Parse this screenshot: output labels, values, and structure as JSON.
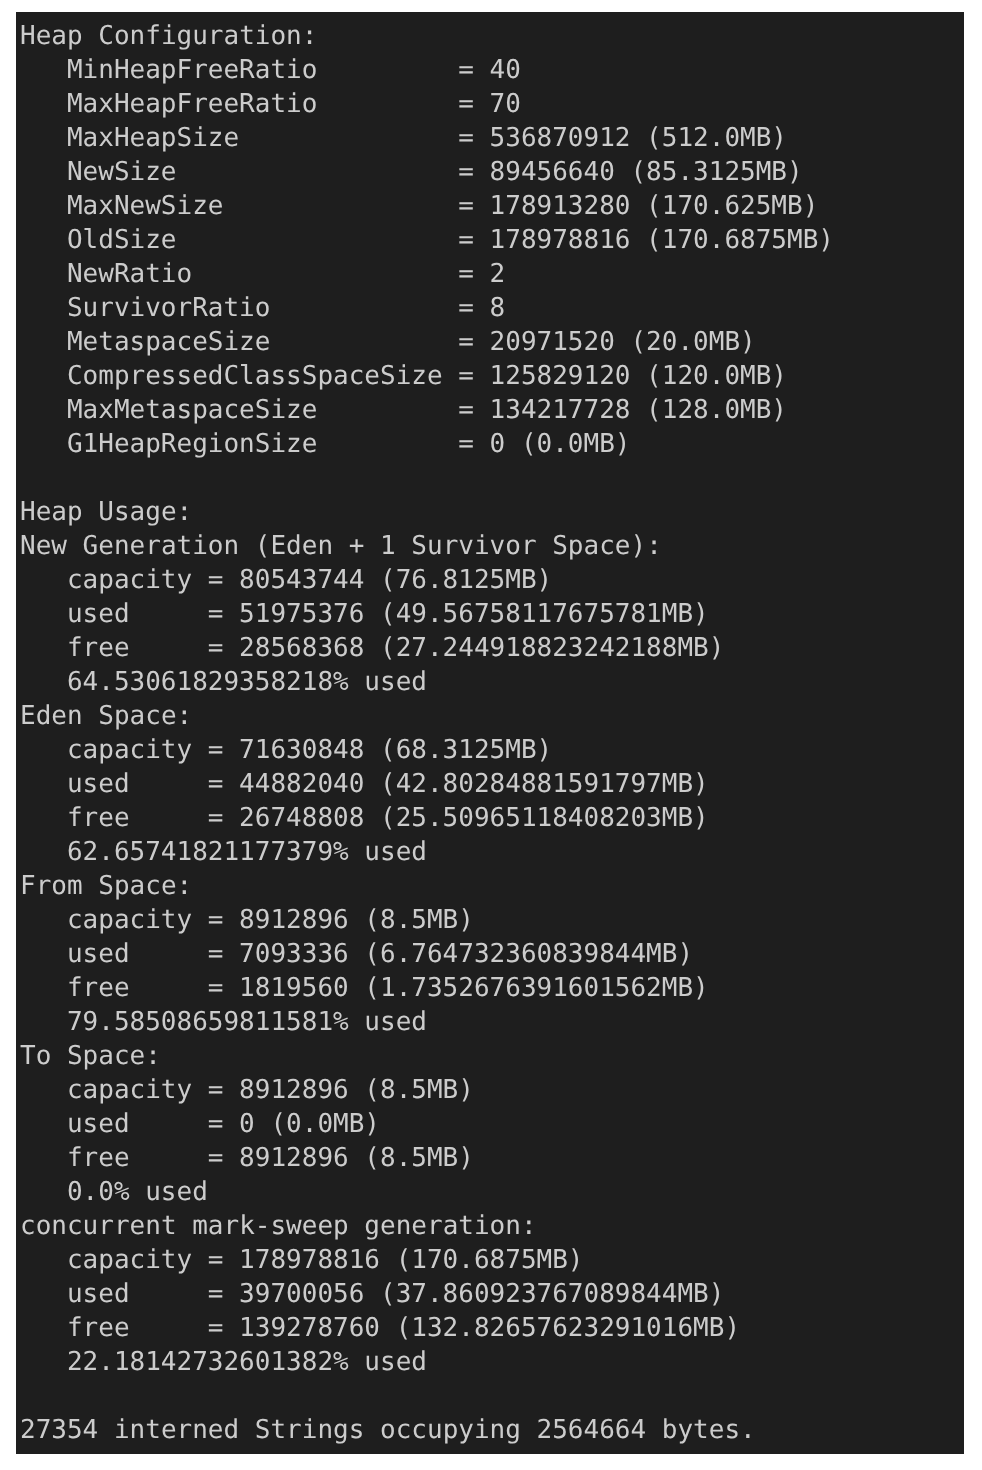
{
  "configuration": {
    "title": "Heap Configuration:",
    "rows": [
      "MinHeapFreeRatio         = 40",
      "MaxHeapFreeRatio         = 70",
      "MaxHeapSize              = 536870912 (512.0MB)",
      "NewSize                  = 89456640 (85.3125MB)",
      "MaxNewSize               = 178913280 (170.625MB)",
      "OldSize                  = 178978816 (170.6875MB)",
      "NewRatio                 = 2",
      "SurvivorRatio            = 8",
      "MetaspaceSize            = 20971520 (20.0MB)",
      "CompressedClassSpaceSize = 125829120 (120.0MB)",
      "MaxMetaspaceSize         = 134217728 (128.0MB)",
      "G1HeapRegionSize         = 0 (0.0MB)"
    ]
  },
  "usage": {
    "title": "Heap Usage:",
    "groups": [
      {
        "title": "New Generation (Eden + 1 Survivor Space):",
        "rows": [
          "capacity = 80543744 (76.8125MB)",
          "used     = 51975376 (49.56758117675781MB)",
          "free     = 28568368 (27.244918823242188MB)",
          "64.53061829358218% used"
        ]
      },
      {
        "title": "Eden Space:",
        "rows": [
          "capacity = 71630848 (68.3125MB)",
          "used     = 44882040 (42.80284881591797MB)",
          "free     = 26748808 (25.50965118408203MB)",
          "62.65741821177379% used"
        ]
      },
      {
        "title": "From Space:",
        "rows": [
          "capacity = 8912896 (8.5MB)",
          "used     = 7093336 (6.764732360839844MB)",
          "free     = 1819560 (1.7352676391601562MB)",
          "79.58508659811581% used"
        ]
      },
      {
        "title": "To Space:",
        "rows": [
          "capacity = 8912896 (8.5MB)",
          "used     = 0 (0.0MB)",
          "free     = 8912896 (8.5MB)",
          "0.0% used"
        ]
      },
      {
        "title": "concurrent mark-sweep generation:",
        "rows": [
          "capacity = 178978816 (170.6875MB)",
          "used     = 39700056 (37.860923767089844MB)",
          "free     = 139278760 (132.82657623291016MB)",
          "22.18142732601382% used"
        ]
      }
    ]
  },
  "footer": "27354 interned Strings occupying 2564664 bytes."
}
